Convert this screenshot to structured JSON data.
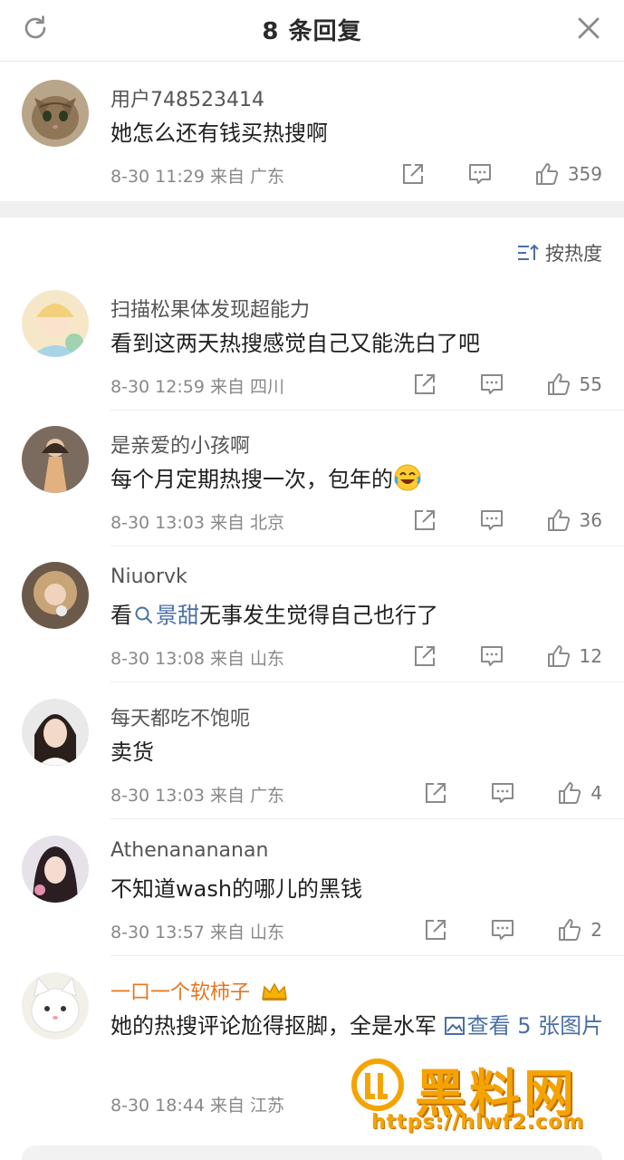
{
  "header": {
    "title": "8 条回复"
  },
  "main_comment": {
    "username": "用户748523414",
    "text": "她怎么还有钱买热搜啊",
    "meta": "8-30 11:29  来自 广东",
    "likes": "359"
  },
  "sort": {
    "label": "按热度"
  },
  "replies": [
    {
      "username": "扫描松果体发现超能力",
      "text": "看到这两天热搜感觉自己又能洗白了吧",
      "meta": "8-30 12:59  来自 四川",
      "likes": "55"
    },
    {
      "username": "是亲爱的小孩啊",
      "text": "每个月定期热搜一次，包年的",
      "meta": "8-30 13:03  来自 北京",
      "likes": "36"
    },
    {
      "username": "Niuorvk",
      "text_before": "看",
      "link": "景甜",
      "text_after": "无事发生觉得自己也行了",
      "meta": "8-30 13:08  来自 山东",
      "likes": "12"
    },
    {
      "username": "每天都吃不饱呃",
      "text": "卖货",
      "meta": "8-30 13:03  来自 广东",
      "likes": "4"
    },
    {
      "username": "Athenanananan",
      "text": "不知道wash的哪儿的黑钱",
      "meta": "8-30 13:57  来自 山东",
      "likes": "2"
    },
    {
      "username": "一口一个软柿子",
      "text": "她的热搜评论尬得抠脚，全是水军",
      "images_link": "查看 5 张图片",
      "meta": "8-30 18:44  来自 江苏"
    }
  ],
  "watermark": {
    "text": "黑料网",
    "url": "https://hlwf2.com"
  },
  "colors": {
    "accent_link": "#4a6fa5",
    "vip_name": "#e8741d",
    "watermark": "#f5a300"
  }
}
